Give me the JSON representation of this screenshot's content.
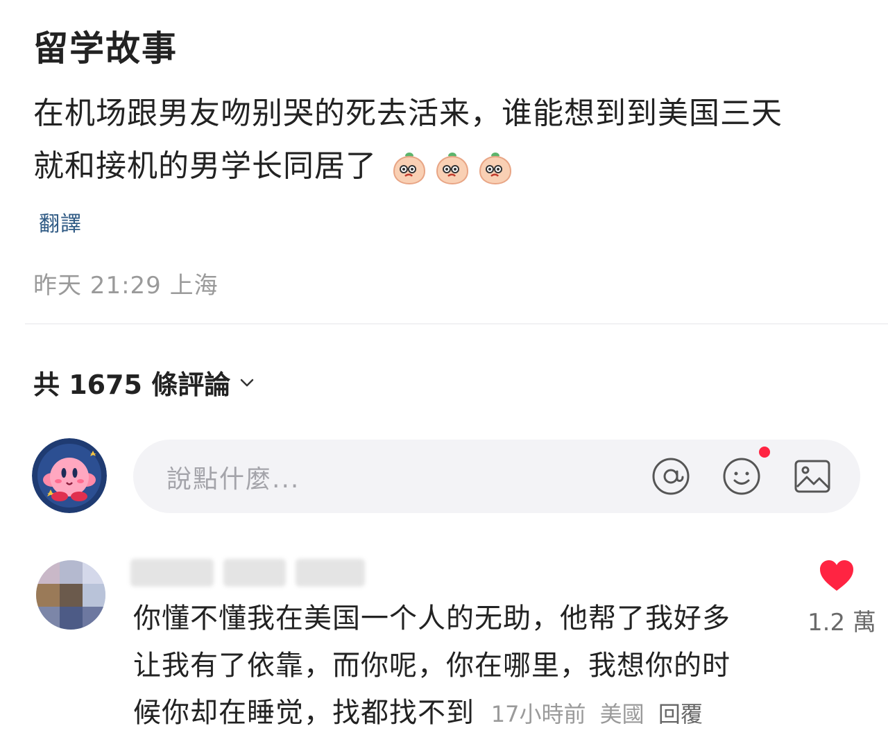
{
  "post": {
    "title": "留学故事",
    "body_line1": "在机场跟男友吻别哭的死去活来，谁能想到到美国三天",
    "body_line2": "就和接机的男学长同居了",
    "translate_label": "翻譯",
    "timestamp": "昨天 21:29",
    "location": "上海"
  },
  "comments_section": {
    "count_label": "共 1675 條評論",
    "input_placeholder": "說點什麼..."
  },
  "comment": {
    "text_line1": "你懂不懂我在美国一个人的无助，他帮了我好多",
    "text_line2": "让我有了依靠，而你呢，你在哪里，我想你的时",
    "text_line3": "候你却在睡觉，找都找不到",
    "time": "17小時前",
    "location": "美國",
    "reply_label": "回覆",
    "like_count": "1.2 萬"
  },
  "colors": {
    "link": "#2f5a84",
    "like": "#ff2442",
    "muted": "#9a9a9a"
  },
  "icons": [
    "peach-emoji-icon",
    "chevron-down-icon",
    "at-icon",
    "emoji-icon",
    "image-icon",
    "heart-icon"
  ]
}
